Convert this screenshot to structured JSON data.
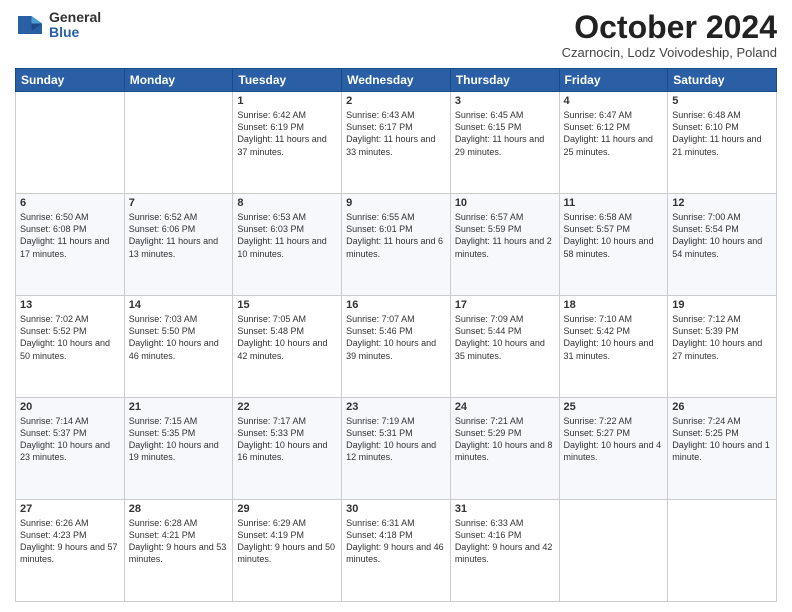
{
  "header": {
    "logo_general": "General",
    "logo_blue": "Blue",
    "month_title": "October 2024",
    "subtitle": "Czarnocin, Lodz Voivodeship, Poland"
  },
  "weekdays": [
    "Sunday",
    "Monday",
    "Tuesday",
    "Wednesday",
    "Thursday",
    "Friday",
    "Saturday"
  ],
  "weeks": [
    [
      {
        "day": "",
        "sunrise": "",
        "sunset": "",
        "daylight": ""
      },
      {
        "day": "",
        "sunrise": "",
        "sunset": "",
        "daylight": ""
      },
      {
        "day": "1",
        "sunrise": "Sunrise: 6:42 AM",
        "sunset": "Sunset: 6:19 PM",
        "daylight": "Daylight: 11 hours and 37 minutes."
      },
      {
        "day": "2",
        "sunrise": "Sunrise: 6:43 AM",
        "sunset": "Sunset: 6:17 PM",
        "daylight": "Daylight: 11 hours and 33 minutes."
      },
      {
        "day": "3",
        "sunrise": "Sunrise: 6:45 AM",
        "sunset": "Sunset: 6:15 PM",
        "daylight": "Daylight: 11 hours and 29 minutes."
      },
      {
        "day": "4",
        "sunrise": "Sunrise: 6:47 AM",
        "sunset": "Sunset: 6:12 PM",
        "daylight": "Daylight: 11 hours and 25 minutes."
      },
      {
        "day": "5",
        "sunrise": "Sunrise: 6:48 AM",
        "sunset": "Sunset: 6:10 PM",
        "daylight": "Daylight: 11 hours and 21 minutes."
      }
    ],
    [
      {
        "day": "6",
        "sunrise": "Sunrise: 6:50 AM",
        "sunset": "Sunset: 6:08 PM",
        "daylight": "Daylight: 11 hours and 17 minutes."
      },
      {
        "day": "7",
        "sunrise": "Sunrise: 6:52 AM",
        "sunset": "Sunset: 6:06 PM",
        "daylight": "Daylight: 11 hours and 13 minutes."
      },
      {
        "day": "8",
        "sunrise": "Sunrise: 6:53 AM",
        "sunset": "Sunset: 6:03 PM",
        "daylight": "Daylight: 11 hours and 10 minutes."
      },
      {
        "day": "9",
        "sunrise": "Sunrise: 6:55 AM",
        "sunset": "Sunset: 6:01 PM",
        "daylight": "Daylight: 11 hours and 6 minutes."
      },
      {
        "day": "10",
        "sunrise": "Sunrise: 6:57 AM",
        "sunset": "Sunset: 5:59 PM",
        "daylight": "Daylight: 11 hours and 2 minutes."
      },
      {
        "day": "11",
        "sunrise": "Sunrise: 6:58 AM",
        "sunset": "Sunset: 5:57 PM",
        "daylight": "Daylight: 10 hours and 58 minutes."
      },
      {
        "day": "12",
        "sunrise": "Sunrise: 7:00 AM",
        "sunset": "Sunset: 5:54 PM",
        "daylight": "Daylight: 10 hours and 54 minutes."
      }
    ],
    [
      {
        "day": "13",
        "sunrise": "Sunrise: 7:02 AM",
        "sunset": "Sunset: 5:52 PM",
        "daylight": "Daylight: 10 hours and 50 minutes."
      },
      {
        "day": "14",
        "sunrise": "Sunrise: 7:03 AM",
        "sunset": "Sunset: 5:50 PM",
        "daylight": "Daylight: 10 hours and 46 minutes."
      },
      {
        "day": "15",
        "sunrise": "Sunrise: 7:05 AM",
        "sunset": "Sunset: 5:48 PM",
        "daylight": "Daylight: 10 hours and 42 minutes."
      },
      {
        "day": "16",
        "sunrise": "Sunrise: 7:07 AM",
        "sunset": "Sunset: 5:46 PM",
        "daylight": "Daylight: 10 hours and 39 minutes."
      },
      {
        "day": "17",
        "sunrise": "Sunrise: 7:09 AM",
        "sunset": "Sunset: 5:44 PM",
        "daylight": "Daylight: 10 hours and 35 minutes."
      },
      {
        "day": "18",
        "sunrise": "Sunrise: 7:10 AM",
        "sunset": "Sunset: 5:42 PM",
        "daylight": "Daylight: 10 hours and 31 minutes."
      },
      {
        "day": "19",
        "sunrise": "Sunrise: 7:12 AM",
        "sunset": "Sunset: 5:39 PM",
        "daylight": "Daylight: 10 hours and 27 minutes."
      }
    ],
    [
      {
        "day": "20",
        "sunrise": "Sunrise: 7:14 AM",
        "sunset": "Sunset: 5:37 PM",
        "daylight": "Daylight: 10 hours and 23 minutes."
      },
      {
        "day": "21",
        "sunrise": "Sunrise: 7:15 AM",
        "sunset": "Sunset: 5:35 PM",
        "daylight": "Daylight: 10 hours and 19 minutes."
      },
      {
        "day": "22",
        "sunrise": "Sunrise: 7:17 AM",
        "sunset": "Sunset: 5:33 PM",
        "daylight": "Daylight: 10 hours and 16 minutes."
      },
      {
        "day": "23",
        "sunrise": "Sunrise: 7:19 AM",
        "sunset": "Sunset: 5:31 PM",
        "daylight": "Daylight: 10 hours and 12 minutes."
      },
      {
        "day": "24",
        "sunrise": "Sunrise: 7:21 AM",
        "sunset": "Sunset: 5:29 PM",
        "daylight": "Daylight: 10 hours and 8 minutes."
      },
      {
        "day": "25",
        "sunrise": "Sunrise: 7:22 AM",
        "sunset": "Sunset: 5:27 PM",
        "daylight": "Daylight: 10 hours and 4 minutes."
      },
      {
        "day": "26",
        "sunrise": "Sunrise: 7:24 AM",
        "sunset": "Sunset: 5:25 PM",
        "daylight": "Daylight: 10 hours and 1 minute."
      }
    ],
    [
      {
        "day": "27",
        "sunrise": "Sunrise: 6:26 AM",
        "sunset": "Sunset: 4:23 PM",
        "daylight": "Daylight: 9 hours and 57 minutes."
      },
      {
        "day": "28",
        "sunrise": "Sunrise: 6:28 AM",
        "sunset": "Sunset: 4:21 PM",
        "daylight": "Daylight: 9 hours and 53 minutes."
      },
      {
        "day": "29",
        "sunrise": "Sunrise: 6:29 AM",
        "sunset": "Sunset: 4:19 PM",
        "daylight": "Daylight: 9 hours and 50 minutes."
      },
      {
        "day": "30",
        "sunrise": "Sunrise: 6:31 AM",
        "sunset": "Sunset: 4:18 PM",
        "daylight": "Daylight: 9 hours and 46 minutes."
      },
      {
        "day": "31",
        "sunrise": "Sunrise: 6:33 AM",
        "sunset": "Sunset: 4:16 PM",
        "daylight": "Daylight: 9 hours and 42 minutes."
      },
      {
        "day": "",
        "sunrise": "",
        "sunset": "",
        "daylight": ""
      },
      {
        "day": "",
        "sunrise": "",
        "sunset": "",
        "daylight": ""
      }
    ]
  ]
}
